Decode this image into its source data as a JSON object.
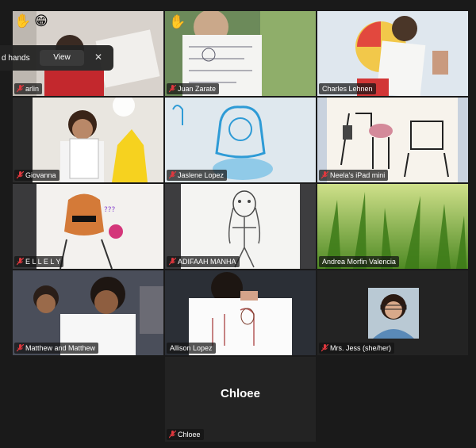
{
  "notification": {
    "text": "d hands",
    "view_label": "View",
    "close_glyph": "✕"
  },
  "reactions": {
    "tile1": [
      "✋",
      "😁"
    ],
    "tile2": [
      "✋"
    ]
  },
  "participants": [
    {
      "name": "arlin",
      "muted": true
    },
    {
      "name": "Juan Zarate",
      "muted": true
    },
    {
      "name": "Charles Lehnen",
      "muted": false
    },
    {
      "name": "Giovanna",
      "muted": true
    },
    {
      "name": "Jaslene Lopez",
      "muted": true
    },
    {
      "name": "Neela's iPad mini",
      "muted": true
    },
    {
      "name": "E L L E L Y",
      "muted": true
    },
    {
      "name": "ADIFAAH MANHA",
      "muted": true
    },
    {
      "name": "Andrea Morfin Valencia",
      "muted": false,
      "active_speaker": true
    },
    {
      "name": "Matthew and Matthew",
      "muted": true
    },
    {
      "name": "Allison Lopez",
      "muted": false
    },
    {
      "name": "Mrs. Jess (she/her)",
      "muted": true
    },
    {
      "name": "Chloee",
      "muted": true,
      "video_off": true,
      "center_label": "Chloee"
    }
  ],
  "colors": {
    "background": "#1a1a1a",
    "tile": "#232323",
    "active_outline": "#d9d23a",
    "muted_icon": "#e0383e"
  }
}
